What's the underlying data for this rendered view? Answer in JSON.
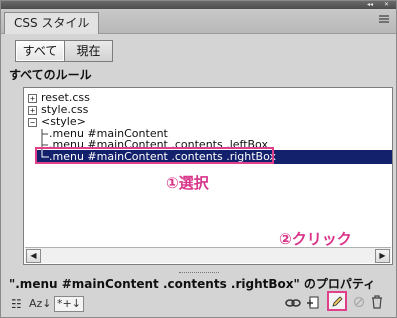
{
  "panel": {
    "strip_buttons": "◂◂",
    "strip_close": "✕",
    "tab_title": "CSS スタイル",
    "menu_icon": "panel-menu-icon"
  },
  "mode": {
    "all_label": "すべて",
    "current_label": "現在"
  },
  "rules": {
    "header": "すべてのルール",
    "items": [
      {
        "expander": "+",
        "label": "reset.css"
      },
      {
        "expander": "+",
        "label": "style.css"
      },
      {
        "expander": "−",
        "label": "<style>"
      },
      {
        "label": ".menu #mainContent"
      },
      {
        "label": ".menu #mainContent .contents .leftBox"
      },
      {
        "label": ".menu #mainContent .contents .rightBox"
      }
    ],
    "selected_index": 5
  },
  "annotations": {
    "select": "①選択",
    "click": "②クリック"
  },
  "scrollbar": {
    "left": "◀",
    "right": "▶"
  },
  "properties": {
    "title": "\".menu #mainContent .contents .rightBox\" のプロパティ"
  },
  "toolbar": {
    "category_view": "☷",
    "sort_az": "Az↓",
    "set_only": "*+↓",
    "attach_icon": "link-icon",
    "new_rule_icon": "new-rule-icon",
    "edit_icon": "edit-pencil-icon",
    "disable_icon": "disable-icon",
    "delete_icon": "trash-icon"
  },
  "colors": {
    "selection": "#13206b",
    "annotation": "#d8358a"
  }
}
